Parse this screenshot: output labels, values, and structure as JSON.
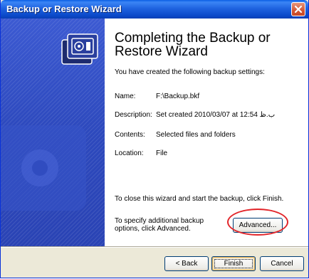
{
  "window": {
    "title": "Backup or Restore Wizard"
  },
  "main": {
    "heading": "Completing the Backup or Restore Wizard",
    "subtext": "You have created the following backup settings:",
    "settings": [
      {
        "label": "Name:",
        "value": "F:\\Backup.bkf"
      },
      {
        "label": "Description:",
        "value": "Set created 2010/03/07 at 12:54 ب.ظ"
      },
      {
        "label": "Contents:",
        "value": "Selected files and folders"
      },
      {
        "label": "Location:",
        "value": "File"
      }
    ],
    "close_text": "To close this wizard and start the backup, click Finish.",
    "advanced_text": "To specify additional backup options, click Advanced.",
    "advanced_label": "Advanced..."
  },
  "footer": {
    "back_label": "< Back",
    "finish_label": "Finish",
    "cancel_label": "Cancel"
  },
  "colors": {
    "highlight": "#e2262b",
    "titlebar": "#0a5ee4",
    "side_panel": "#2d49bd"
  },
  "icons": [
    "close-icon",
    "backup-icon"
  ]
}
